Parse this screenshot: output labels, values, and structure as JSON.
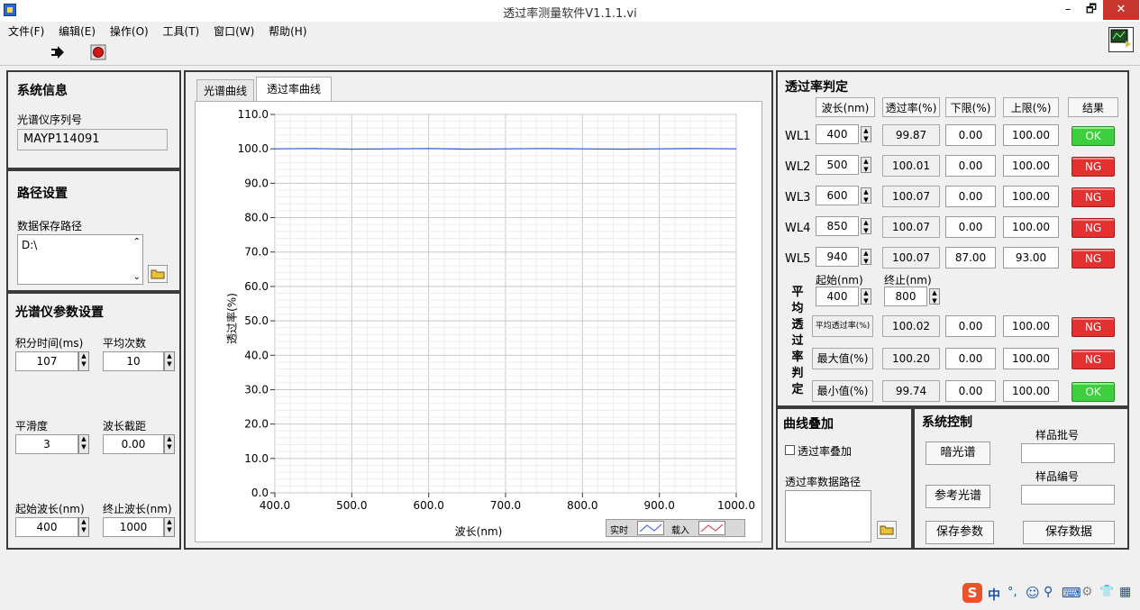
{
  "window": {
    "title": "透过率测量软件V1.1.1.vi",
    "min": "–",
    "restore": "🗗",
    "close": "✕"
  },
  "menu": [
    "文件(F)",
    "编辑(E)",
    "操作(O)",
    "工具(T)",
    "窗口(W)",
    "帮助(H)"
  ],
  "system_info": {
    "title": "系统信息",
    "serial_label": "光谱仪序列号",
    "serial_value": "MAYP114091"
  },
  "path": {
    "title": "路径设置",
    "label": "数据保存路径",
    "value": "D:\\"
  },
  "spectrometer": {
    "title": "光谱仪参数设置",
    "integration_label": "积分时间(ms)",
    "integration_value": "107",
    "average_label": "平均次数",
    "average_value": "10",
    "smooth_label": "平滑度",
    "smooth_value": "3",
    "cutoff_label": "波长截距",
    "cutoff_value": "0.00",
    "start_label": "起始波长(nm)",
    "start_value": "400",
    "end_label": "终止波长(nm)",
    "end_value": "1000"
  },
  "tabs": [
    "光谱曲线",
    "透过率曲线"
  ],
  "legend": {
    "realtime": "实时",
    "loaded": "载入"
  },
  "chart_data": {
    "type": "line",
    "xlabel": "波长(nm)",
    "ylabel": "透过率(%)",
    "xlim": [
      400,
      1000
    ],
    "ylim": [
      0,
      110
    ],
    "x_ticks": [
      "400.0",
      "500.0",
      "600.0",
      "700.0",
      "800.0",
      "900.0",
      "1000.0"
    ],
    "y_ticks": [
      "0.0",
      "10.0",
      "20.0",
      "30.0",
      "40.0",
      "50.0",
      "60.0",
      "70.0",
      "80.0",
      "90.0",
      "100.0",
      "110.0"
    ],
    "series": [
      {
        "x": [
          400,
          450,
          500,
          550,
          600,
          650,
          700,
          750,
          800,
          850,
          900,
          950,
          1000
        ],
        "y": [
          100.0,
          100.1,
          99.9,
          100.0,
          100.1,
          99.9,
          100.0,
          100.1,
          100.0,
          99.9,
          100.0,
          100.1,
          100.0
        ]
      }
    ],
    "grid": true
  },
  "judge": {
    "title": "透过率判定",
    "headers": [
      "波长(nm)",
      "透过率(%)",
      "下限(%)",
      "上限(%)",
      "结果"
    ],
    "rows": [
      {
        "name": "WL1",
        "wl": "400",
        "trans": "99.87",
        "low": "0.00",
        "high": "100.00",
        "result": "OK"
      },
      {
        "name": "WL2",
        "wl": "500",
        "trans": "100.01",
        "low": "0.00",
        "high": "100.00",
        "result": "NG"
      },
      {
        "name": "WL3",
        "wl": "600",
        "trans": "100.07",
        "low": "0.00",
        "high": "100.00",
        "result": "NG"
      },
      {
        "name": "WL4",
        "wl": "850",
        "trans": "100.07",
        "low": "0.00",
        "high": "100.00",
        "result": "NG"
      },
      {
        "name": "WL5",
        "wl": "940",
        "trans": "100.07",
        "low": "87.00",
        "high": "93.00",
        "result": "NG"
      }
    ],
    "avg_vertical": [
      "平",
      "均",
      "透",
      "过",
      "率",
      "判",
      "定"
    ],
    "start_label": "起始(nm)",
    "start_value": "400",
    "end_label": "终止(nm)",
    "end_value": "800",
    "stats": [
      {
        "label": "平均透过率(%)",
        "value": "100.02",
        "low": "0.00",
        "high": "100.00",
        "result": "NG"
      },
      {
        "label": "最大值(%)",
        "value": "100.20",
        "low": "0.00",
        "high": "100.00",
        "result": "NG"
      },
      {
        "label": "最小值(%)",
        "value": "99.74",
        "low": "0.00",
        "high": "100.00",
        "result": "OK"
      }
    ]
  },
  "overlay": {
    "title": "曲线叠加",
    "check_label": "透过率叠加",
    "path_label": "透过率数据路径"
  },
  "control": {
    "title": "系统控制",
    "dark": "暗光谱",
    "ref": "参考光谱",
    "save_param": "保存参数",
    "save_data": "保存数据",
    "batch_label": "样品批号",
    "id_label": "样品编号"
  },
  "tray": [
    "中",
    "°,",
    "☺",
    "⚲",
    "⌨",
    "⚙",
    "👕",
    "▦"
  ]
}
